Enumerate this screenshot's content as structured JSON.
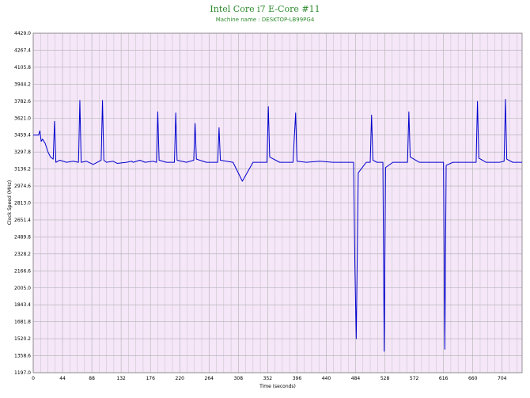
{
  "chart_data": {
    "type": "line",
    "title": "Intel Core i7 E-Core #11",
    "subtitle": "Machine name : DESKTOP-LB99PG4",
    "xlabel": "Time (seconds)",
    "ylabel": "Clock Speed (MHz)",
    "xlim": [
      0,
      734
    ],
    "ylim": [
      1197.0,
      4429.0
    ],
    "xticks": [
      0,
      44,
      88,
      132,
      176,
      220,
      264,
      308,
      352,
      396,
      440,
      484,
      528,
      572,
      616,
      660,
      704
    ],
    "yticks": [
      "4429.0",
      "4267.4",
      "4105.8",
      "3944.2",
      "3782.6",
      "3621.0",
      "3459.4",
      "3297.8",
      "3136.2",
      "2974.6",
      "2813.0",
      "2651.4",
      "2489.8",
      "2328.2",
      "2166.6",
      "2005.0",
      "1843.4",
      "1681.8",
      "1520.2",
      "1358.6",
      "1197.0"
    ],
    "grid": true,
    "colors": {
      "background": "#f5e6f8",
      "line": "#0000cd",
      "grid": "#b0b0b0",
      "title": "#2e8b2e"
    },
    "series": [
      {
        "name": "",
        "x": [
          0,
          8,
          10,
          12,
          14,
          18,
          22,
          26,
          30,
          32,
          34,
          40,
          50,
          60,
          68,
          70,
          72,
          80,
          90,
          96,
          102,
          104,
          106,
          110,
          120,
          126,
          140,
          148,
          150,
          160,
          168,
          180,
          185,
          187,
          189,
          200,
          212,
          214,
          216,
          230,
          241,
          243,
          245,
          260,
          277,
          279,
          281,
          300,
          314,
          330,
          351,
          353,
          355,
          370,
          390,
          394,
          396,
          410,
          430,
          450,
          470,
          481,
          483,
          485,
          488,
          500,
          506,
          508,
          510,
          516,
          525,
          527,
          529,
          540,
          550,
          562,
          564,
          566,
          580,
          600,
          616,
          618,
          620,
          630,
          640,
          665,
          667,
          669,
          680,
          700,
          707,
          709,
          711,
          720,
          734
        ],
        "values": [
          3459,
          3459,
          3500,
          3400,
          3420,
          3380,
          3300,
          3250,
          3230,
          3590,
          3200,
          3220,
          3200,
          3210,
          3200,
          3790,
          3200,
          3210,
          3180,
          3200,
          3220,
          3790,
          3220,
          3200,
          3210,
          3190,
          3200,
          3210,
          3200,
          3220,
          3200,
          3210,
          3200,
          3680,
          3220,
          3200,
          3200,
          3670,
          3220,
          3200,
          3220,
          3570,
          3230,
          3200,
          3200,
          3530,
          3220,
          3200,
          3020,
          3200,
          3200,
          3730,
          3250,
          3200,
          3200,
          3670,
          3210,
          3200,
          3210,
          3200,
          3200,
          3200,
          2200,
          1520,
          3100,
          3200,
          3200,
          3650,
          3220,
          3200,
          3200,
          1400,
          3150,
          3200,
          3200,
          3200,
          3680,
          3250,
          3200,
          3200,
          3200,
          1420,
          3170,
          3200,
          3200,
          3200,
          3780,
          3240,
          3200,
          3200,
          3210,
          3800,
          3230,
          3200,
          3200
        ]
      }
    ]
  }
}
